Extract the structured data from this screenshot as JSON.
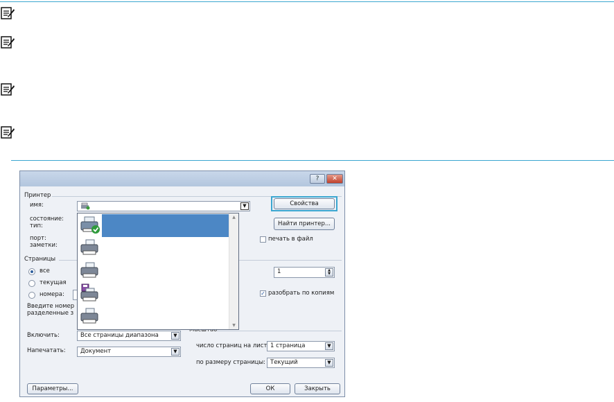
{
  "printer": {
    "group_label": "Принтер",
    "name_label": "имя:",
    "status_label": "состояние:",
    "type_label": "тип:",
    "port_label": "порт:",
    "notes_label": "заметки:",
    "properties_button": "Свойства",
    "find_printer_button": "Найти принтер...",
    "print_to_file_label": "печать в файл"
  },
  "pages": {
    "group_label": "Страницы",
    "all_label": "все",
    "current_label": "текущая",
    "numbers_label": "номера:",
    "hint_line1": "Введите номер",
    "hint_line2": "разделенные з"
  },
  "copies": {
    "count_value": "1",
    "collate_label": "разобрать по копиям"
  },
  "include": {
    "label": "Включить:",
    "value": "Все страницы диапазона"
  },
  "print_what": {
    "label": "Напечатать:",
    "value": "Документ"
  },
  "zoom": {
    "group_label": "Масштаб",
    "pages_per_sheet_label": "число страниц на листе:",
    "pages_per_sheet_value": "1 страница",
    "scale_label": "по размеру страницы:",
    "scale_value": "Текущий"
  },
  "footer": {
    "options_button": "Параметры...",
    "ok_button": "ОК",
    "close_button": "Закрыть"
  },
  "titlebar": {
    "help_glyph": "?",
    "close_glyph": "✕"
  },
  "dropdown_icons": [
    "printer-check-icon",
    "printer-icon",
    "printer-icon",
    "fax-printer-icon",
    "printer-icon"
  ],
  "colors": {
    "accent": "#3aa6d0",
    "selection": "#4c87c5"
  }
}
